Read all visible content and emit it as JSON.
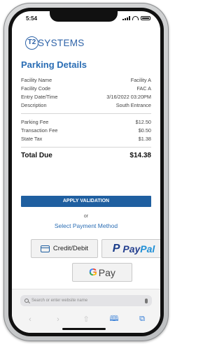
{
  "status_bar": {
    "time": "5:54"
  },
  "brand": {
    "logo_mark": "T2",
    "logo_text": "SYSTEMS",
    "color": "#2e63a8"
  },
  "parking": {
    "title": "Parking Details",
    "details": [
      {
        "label": "Facility Name",
        "value": "Facility A"
      },
      {
        "label": "Facility Code",
        "value": "FAC A"
      },
      {
        "label": "Entry Date/Time",
        "value": "3/16/2022 03:20PM"
      },
      {
        "label": "Description",
        "value": "South Entrance"
      }
    ],
    "fees": [
      {
        "label": "Parking Fee",
        "value": "$12.50"
      },
      {
        "label": "Transaction Fee",
        "value": "$0.50"
      },
      {
        "label": "State Tax",
        "value": "$1.38"
      }
    ],
    "total": {
      "label": "Total Due",
      "value": "$14.38"
    }
  },
  "actions": {
    "apply_validation": "APPLY VALIDATION",
    "or": "or",
    "select_payment": "Select Payment Method"
  },
  "payment_methods": {
    "credit": {
      "label": "Credit/Debit",
      "icon": "credit-card-icon"
    },
    "paypal": {
      "mark": "P",
      "label_dark": "Pay",
      "label_light": "Pal"
    },
    "gpay": {
      "mark": "G",
      "label": "Pay"
    }
  },
  "browser": {
    "url_placeholder": "Search or enter website name",
    "toolbar_icons": [
      "back-icon",
      "forward-icon",
      "share-icon",
      "bookmarks-icon",
      "tabs-icon"
    ]
  },
  "colors": {
    "primary_blue": "#1f5fa0",
    "link_blue": "#2a6db4",
    "safari_blue": "#2f7ad6"
  }
}
